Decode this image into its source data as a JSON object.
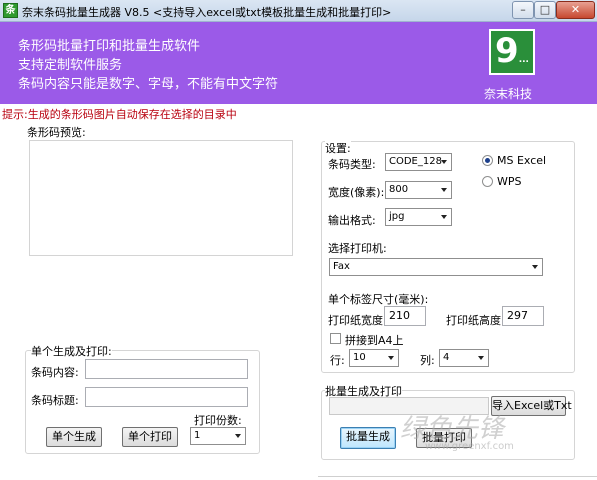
{
  "window": {
    "title": "奈末条码批量生成器 V8.5  <支持导入excel或txt模板批量生成和批量打印>",
    "app_icon_glyph": "条",
    "min_glyph": "–",
    "max_glyph": "□",
    "close_glyph": "✕"
  },
  "banner": {
    "lines": [
      "条形码批量打印和批量生成软件",
      "支持定制软件服务",
      "条码内容只能是数字、字母，不能有中文字符"
    ],
    "logo_text": "9",
    "logo_dots": "...",
    "company": "奈末科技",
    "background": "#9b5ae8"
  },
  "tip": "提示:生成的条形码图片自动保存在选择的目录中",
  "preview": {
    "label": "条形码预览:"
  },
  "settings": {
    "label": "设置:",
    "barcode_type_label": "条码类型:",
    "barcode_type_value": "CODE_128",
    "width_label": "宽度(像素):",
    "width_value": "800",
    "format_label": "输出格式:",
    "format_value": "jpg",
    "radio_ms": "MS  Excel",
    "radio_wps": "WPS",
    "printer_label": "选择打印机:",
    "printer_value": "Fax",
    "label_size_title": "单个标签尺寸(毫米):",
    "paper_width_label": "打印纸宽度:",
    "paper_width_value": "210",
    "paper_height_label": "打印纸高度:",
    "paper_height_value": "297",
    "a4_checkbox": "拼接到A4上",
    "rows_label": "行:",
    "rows_value": "10",
    "cols_label": "列:",
    "cols_value": "4"
  },
  "single": {
    "title": "单个生成及打印:",
    "content_label": "条码内容:",
    "content_value": "",
    "caption_label": "条码标题:",
    "caption_value": "",
    "copies_label": "打印份数:",
    "copies_value": "1",
    "generate_btn": "单个生成",
    "print_btn": "单个打印"
  },
  "batch": {
    "title": "批量生成及打印",
    "path_value": "",
    "import_btn": "导入Excel或Txt",
    "generate_btn": "批量生成",
    "print_btn": "批量打印"
  },
  "watermark": {
    "text": "绿色先锋",
    "url": "www.greenxf.com"
  }
}
